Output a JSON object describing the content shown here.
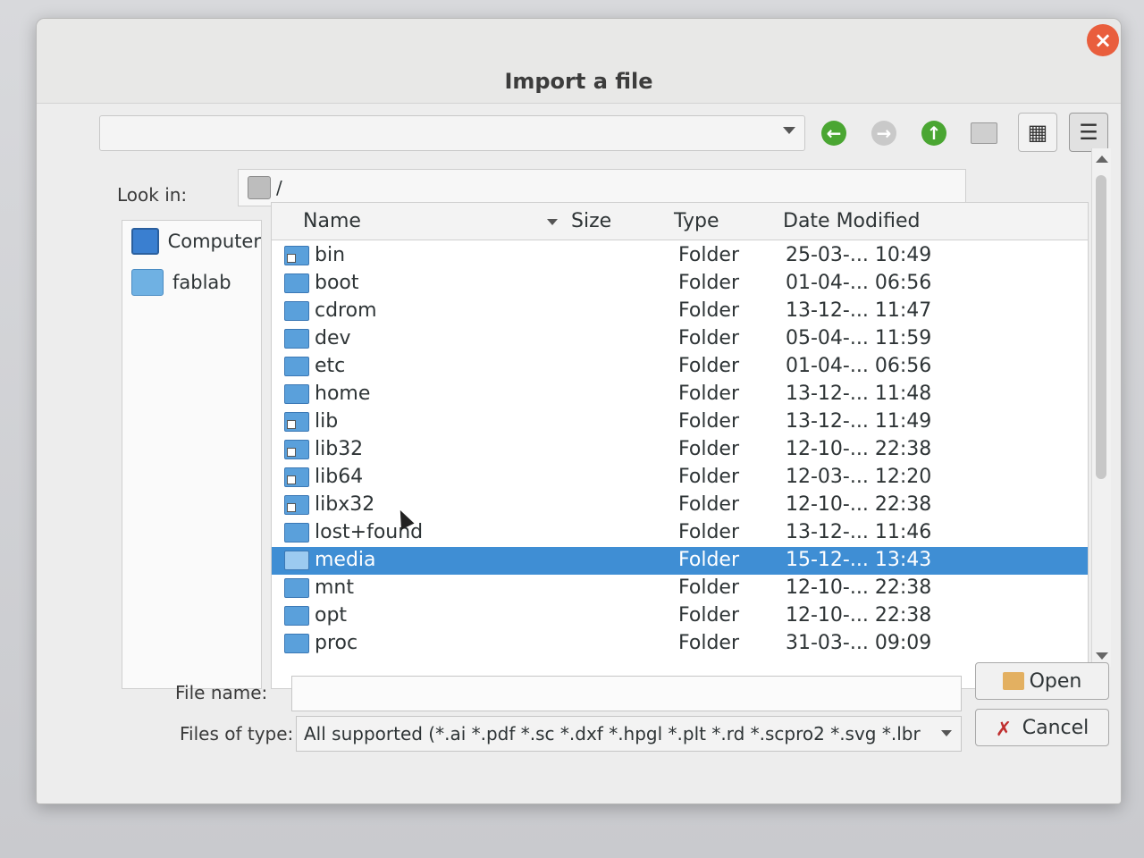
{
  "dialog": {
    "title": "Import a file",
    "close_label": "×"
  },
  "toolbar": {
    "back_icon": "back-arrow-icon",
    "forward_icon": "forward-arrow-icon",
    "up_icon": "up-arrow-icon",
    "new_folder_icon": "new-folder-icon",
    "icon_view_icon": "icon-view-icon",
    "list_view_icon": "list-view-icon"
  },
  "look_in": {
    "label": "Look in:",
    "value": "/"
  },
  "sidebar": {
    "items": [
      {
        "label": "Computer",
        "icon": "computer-icon"
      },
      {
        "label": "fablab",
        "icon": "folder-icon"
      }
    ]
  },
  "file_list": {
    "columns": {
      "name": "Name",
      "size": "Size",
      "type": "Type",
      "date": "Date Modified"
    },
    "rows": [
      {
        "name": "bin",
        "type": "Folder",
        "date": "25-03-... 10:49",
        "link": true
      },
      {
        "name": "boot",
        "type": "Folder",
        "date": "01-04-... 06:56",
        "link": false
      },
      {
        "name": "cdrom",
        "type": "Folder",
        "date": "13-12-... 11:47",
        "link": false
      },
      {
        "name": "dev",
        "type": "Folder",
        "date": "05-04-... 11:59",
        "link": false
      },
      {
        "name": "etc",
        "type": "Folder",
        "date": "01-04-... 06:56",
        "link": false
      },
      {
        "name": "home",
        "type": "Folder",
        "date": "13-12-... 11:48",
        "link": false
      },
      {
        "name": "lib",
        "type": "Folder",
        "date": "13-12-... 11:49",
        "link": true
      },
      {
        "name": "lib32",
        "type": "Folder",
        "date": "12-10-... 22:38",
        "link": true
      },
      {
        "name": "lib64",
        "type": "Folder",
        "date": "12-03-... 12:20",
        "link": true
      },
      {
        "name": "libx32",
        "type": "Folder",
        "date": "12-10-... 22:38",
        "link": true
      },
      {
        "name": "lost+found",
        "type": "Folder",
        "date": "13-12-... 11:46",
        "link": false
      },
      {
        "name": "media",
        "type": "Folder",
        "date": "15-12-... 13:43",
        "link": false,
        "selected": true
      },
      {
        "name": "mnt",
        "type": "Folder",
        "date": "12-10-... 22:38",
        "link": false
      },
      {
        "name": "opt",
        "type": "Folder",
        "date": "12-10-... 22:38",
        "link": false
      },
      {
        "name": "proc",
        "type": "Folder",
        "date": "31-03-... 09:09",
        "link": false
      }
    ]
  },
  "bottom": {
    "file_name_label": "File name:",
    "file_name_value": "",
    "files_of_type_label": "Files of type:",
    "files_of_type_value": "All supported (*.ai *.pdf *.sc *.dxf *.hpgl *.plt *.rd *.scpro2 *.svg *.lbr",
    "open_label": "Open",
    "cancel_label": "Cancel"
  },
  "colors": {
    "selection": "#3f8ed4",
    "close_button": "#e95e3d",
    "nav_green": "#4aa632",
    "folder_blue": "#5aa0db"
  }
}
